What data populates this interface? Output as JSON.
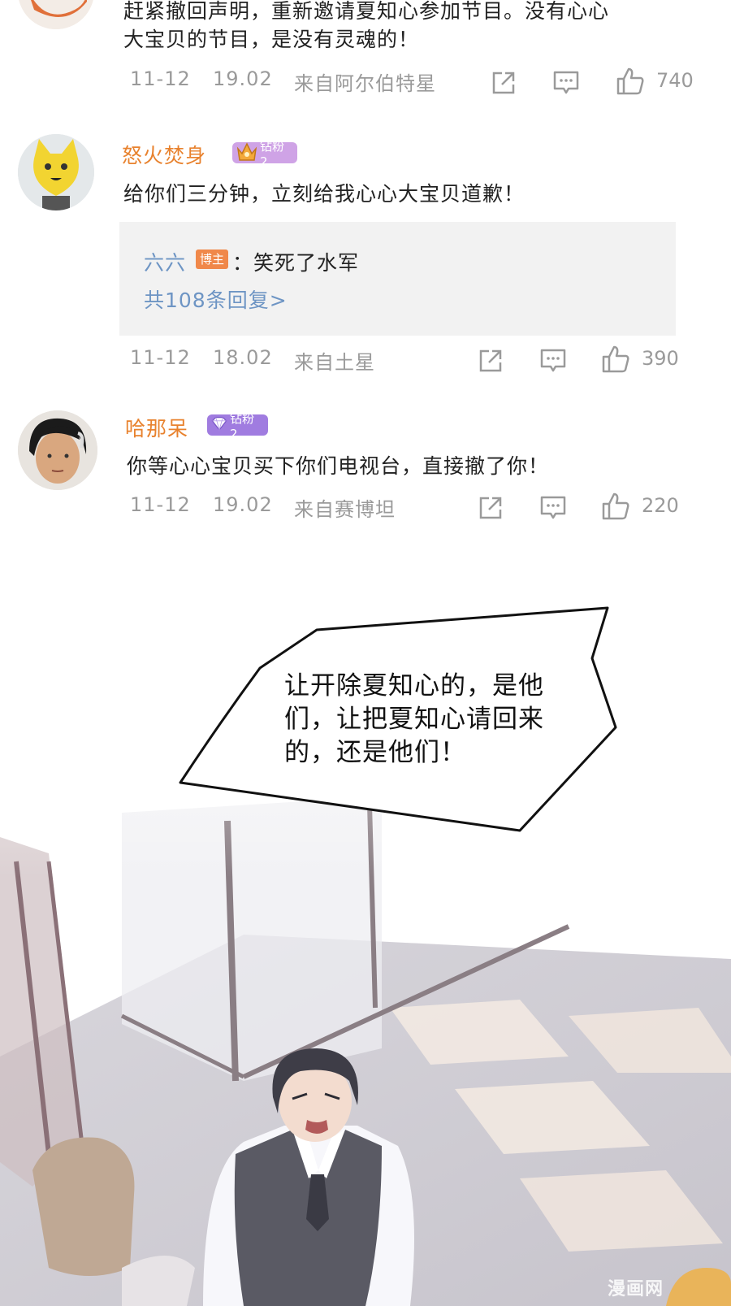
{
  "comments": [
    {
      "text_lines": [
        "赶紧撤回声明，重新邀请夏知心参加节目。没有心心",
        "大宝贝的节目，是没有灵魂的！"
      ],
      "date": "11-12",
      "time": "19.02",
      "source": "来自阿尔伯特星",
      "likes": "740"
    },
    {
      "username": "怒火焚身",
      "badge": "钻粉2",
      "text": "给你们三分钟，立刻给我心心大宝贝道歉！",
      "reply": {
        "name": "六六",
        "tag": "博主",
        "text": "：笑死了水军",
        "more": "共108条回复>"
      },
      "date": "11-12",
      "time": "18.02",
      "source": "来自土星",
      "likes": "390"
    },
    {
      "username": "哈那呆",
      "badge": "钻粉2",
      "text": "你等心心宝贝买下你们电视台，直接撤了你！",
      "date": "11-12",
      "time": "19.02",
      "source": "来自赛博坦",
      "likes": "220"
    }
  ],
  "speech_bubble": {
    "lines": [
      "让开除夏知心的，是他",
      "们，让把夏知心请回来",
      "的，还是他们！"
    ]
  },
  "watermark": "漫画网",
  "colors": {
    "username": "#e8822e",
    "meta": "#9a9a9a",
    "reply_link": "#6e95c4",
    "badge_orange": "#f0a24a",
    "badge_purple": "#a07ce0",
    "host_tag": "#f0884a"
  },
  "icons": [
    "share-icon",
    "comment-icon",
    "like-icon"
  ]
}
